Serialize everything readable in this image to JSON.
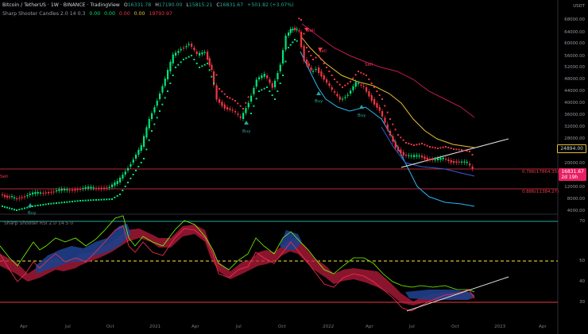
{
  "header": {
    "symbol_line": "Bitcoin / TetherUS · 1W · BINANCE · TradingView",
    "ohlc": [
      {
        "label": "O",
        "value": "16331.78"
      },
      {
        "label": "H",
        "value": "17190.00"
      },
      {
        "label": "L",
        "value": "15815.21"
      },
      {
        "label": "C",
        "value": "16831.67"
      },
      {
        "label": "",
        "value": "+501.82 (+3.07%)"
      }
    ],
    "indicator1": "Sharp Shooter Candles 2.0 14 0.3",
    "indicator1_values": [
      "0.00",
      "0.00",
      "0.00",
      "0.00",
      "19793.97"
    ],
    "indicator2": "Sharp Shooter RSI 2.0 14 5 0"
  },
  "price_axis": {
    "currency": "USDT",
    "ticks": [
      "68000.00",
      "64000.00",
      "60000.00",
      "56000.00",
      "52000.00",
      "48000.00",
      "44000.00",
      "40000.00",
      "36000.00",
      "32000.00",
      "28000.00",
      "20000.00",
      "16000.00",
      "12000.00",
      "8000.00",
      "4000.00"
    ]
  },
  "price_tags": {
    "current": "16831.67",
    "countdown": "2d 19h",
    "level": "24894.00"
  },
  "fib_labels": {
    "upper": "0.786(17864.35)",
    "lower": "0.886(11384.27)"
  },
  "rsi_axis": {
    "ticks": [
      "70",
      "50",
      "40",
      "30"
    ]
  },
  "time_axis": {
    "ticks": [
      "Apr",
      "Jul",
      "Oct",
      "2021",
      "Apr",
      "Jul",
      "Oct",
      "2022",
      "Apr",
      "Jul",
      "Oct",
      "2023",
      "Apr",
      "Jul"
    ]
  },
  "signals": {
    "buy": "Buy",
    "sell": "Sell"
  },
  "colors": {
    "bull": "#26a69a",
    "bull_bright": "#00e676",
    "bear": "#f23645",
    "band_red": "#c2185b",
    "band_yellow": "#e6c02d",
    "band_blue": "#29b6f6",
    "rsi_lime": "#7cfc00",
    "rsi_red": "#ff2d55",
    "line70": "#26a69a",
    "line50": "#ffeb3b",
    "line30": "#f23645"
  }
}
